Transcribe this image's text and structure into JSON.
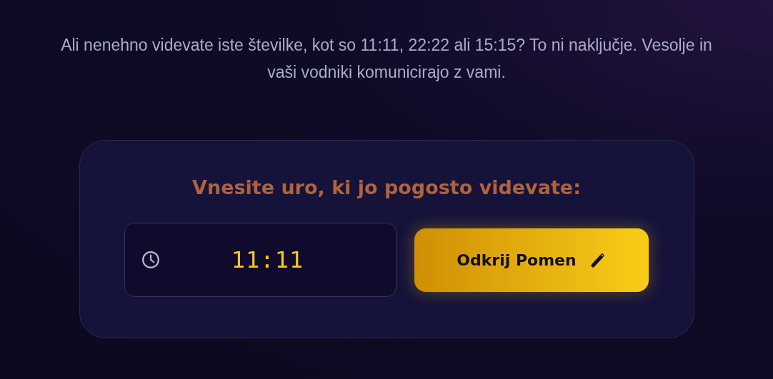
{
  "intro": "Ali nenehno videvate iste številke, kot so 11:11, 22:22 ali 15:15? To ni naključje. Vesolje in vaši vodniki komunicirajo z vami.",
  "card": {
    "title": "Vnesite uro, ki jo pogosto videvate:",
    "time_field": {
      "value": "11:11"
    },
    "button": {
      "label": "Odkrij Pomen"
    }
  }
}
